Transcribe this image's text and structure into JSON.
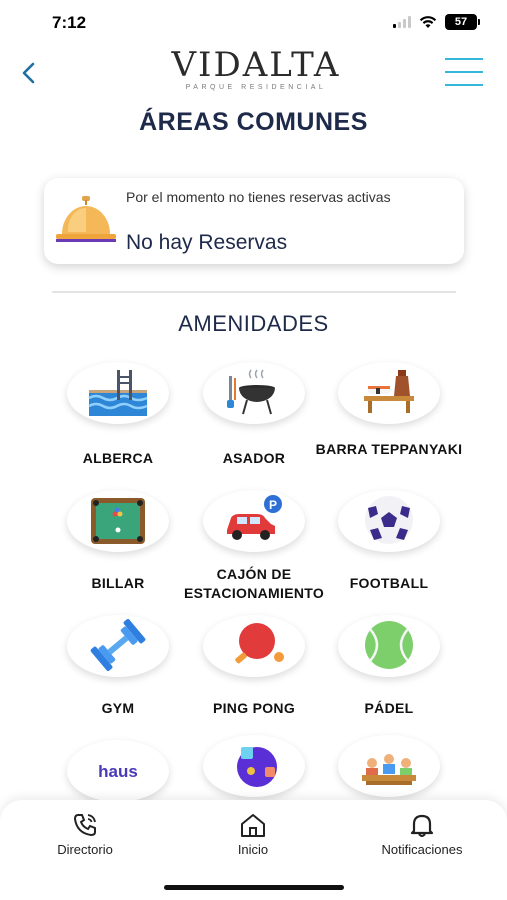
{
  "status": {
    "time": "7:12",
    "battery": "57"
  },
  "header": {
    "logo": "VIDALTA",
    "logo_sub": "PARQUE RESIDENCIAL"
  },
  "title": "ÁREAS COMUNES",
  "reservations": {
    "message": "Por el momento no tienes reservas activas",
    "status": "No hay Reservas"
  },
  "section_title": "AMENIDADES",
  "amenities": [
    {
      "label": "ALBERCA",
      "icon": "pool-icon"
    },
    {
      "label": "ASADOR",
      "icon": "grill-icon"
    },
    {
      "label": "BARRA TEPPANYAKI",
      "icon": "teppanyaki-icon"
    },
    {
      "label": "BILLAR",
      "icon": "billiards-icon"
    },
    {
      "label": "CAJÓN DE ESTACIONAMIENTO",
      "icon": "parking-icon"
    },
    {
      "label": "FOOTBALL",
      "icon": "soccer-ball-icon"
    },
    {
      "label": "GYM",
      "icon": "dumbbell-icon"
    },
    {
      "label": "PING PONG",
      "icon": "ping-pong-icon"
    },
    {
      "label": "PÁDEL",
      "icon": "tennis-ball-icon"
    },
    {
      "label": "haus",
      "icon": "haus-logo-icon"
    },
    {
      "label": "",
      "icon": "game-icon"
    },
    {
      "label": "",
      "icon": "meeting-table-icon"
    }
  ],
  "nav": [
    {
      "label": "Directorio",
      "icon": "phone-icon"
    },
    {
      "label": "Inicio",
      "icon": "home-icon"
    },
    {
      "label": "Notificaciones",
      "icon": "bell-icon"
    }
  ],
  "colors": {
    "accent": "#34b7d8",
    "title": "#1e2a4a",
    "back": "#1e6fa0"
  }
}
